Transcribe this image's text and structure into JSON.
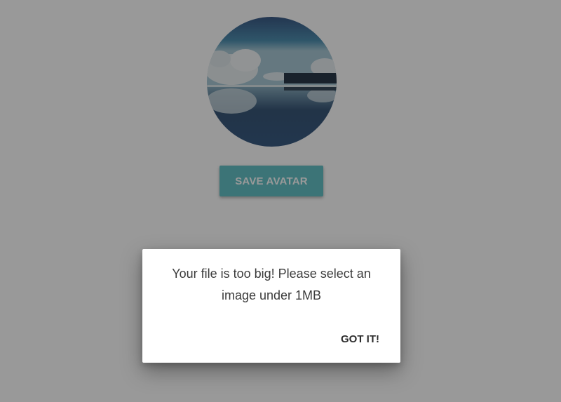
{
  "avatar": {
    "image": "landscape-lake-reflection"
  },
  "save_button": {
    "label": "SAVE AVATAR",
    "color": "#64c2c6"
  },
  "dialog": {
    "message": "Your file is too big! Please select an image under 1MB",
    "action_label": "GOT IT!"
  }
}
